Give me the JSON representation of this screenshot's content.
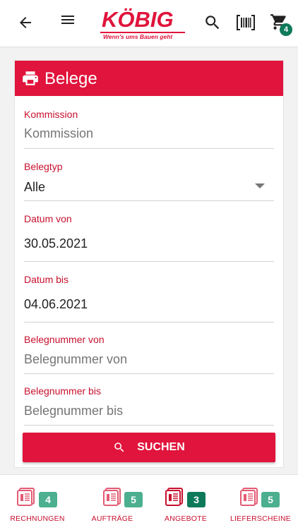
{
  "header": {
    "logo_word": "KÖBIG",
    "logo_tagline": "Wenn's ums Bauen geht",
    "cart_count": "4",
    "icons": [
      "back-arrow-icon",
      "menu-icon",
      "search-icon",
      "barcode-scanner-icon",
      "cart-icon"
    ]
  },
  "colors": {
    "brand_red": "#e0143c",
    "badge_green": "#4caf8f",
    "badge_green_active": "#0f7a5a"
  },
  "card": {
    "title": "Belege",
    "icon": "printer-icon",
    "fields": {
      "kommission": {
        "label": "Kommission",
        "value": "",
        "placeholder": "Kommission"
      },
      "belegtyp": {
        "label": "Belegtyp",
        "value": "Alle"
      },
      "datum_von": {
        "label": "Datum von",
        "value": "30.05.2021"
      },
      "datum_bis": {
        "label": "Datum bis",
        "value": "04.06.2021"
      },
      "belegnummer_von": {
        "label": "Belegnummer von",
        "value": "",
        "placeholder": "Belegnummer von"
      },
      "belegnummer_bis": {
        "label": "Belegnummer bis",
        "value": "",
        "placeholder": "Belegnummer bis"
      }
    },
    "search_button": "SUCHEN"
  },
  "bottom_nav": [
    {
      "label": "RECHNUNGEN",
      "count": "4",
      "active": false
    },
    {
      "label": "AUFTRÄGE",
      "count": "5",
      "active": false
    },
    {
      "label": "ANGEBOTE",
      "count": "3",
      "active": true
    },
    {
      "label": "LIEFERSCHEINE",
      "count": "5",
      "active": false
    }
  ]
}
